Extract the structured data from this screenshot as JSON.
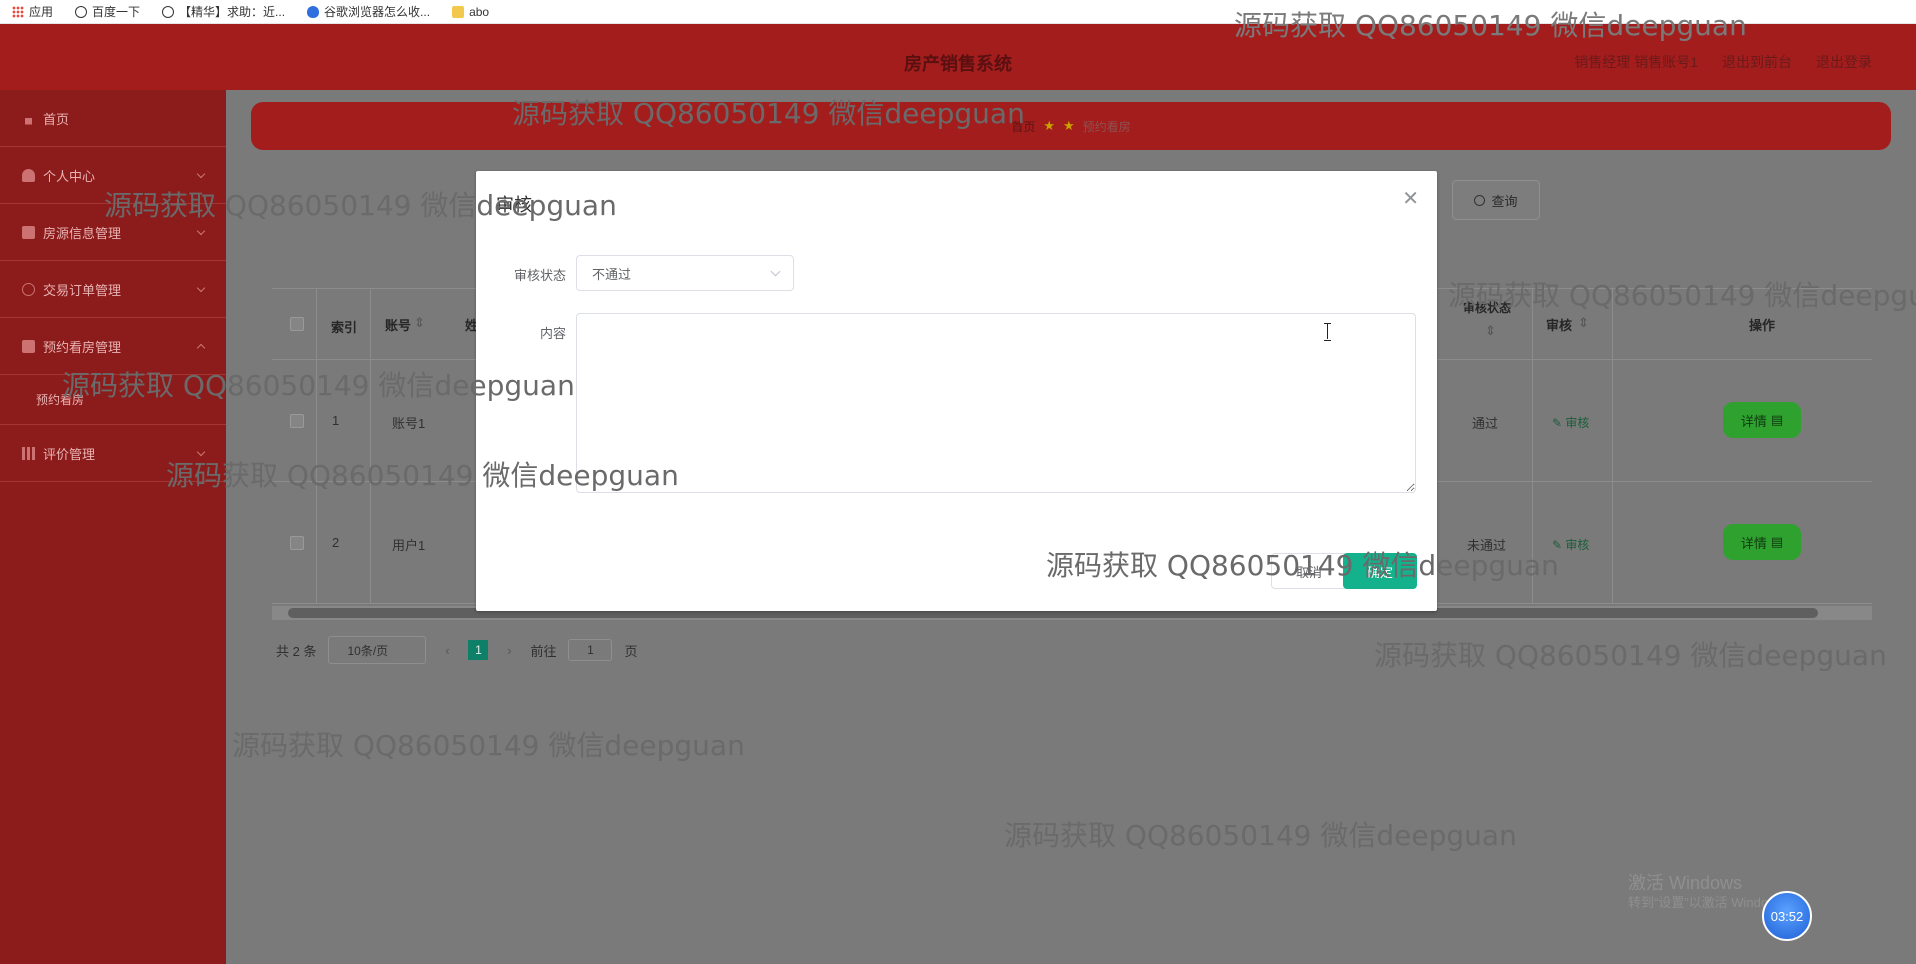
{
  "bookmarks": [
    {
      "label": "应用",
      "icon": "apps-grid-icon"
    },
    {
      "label": "百度一下",
      "icon": "globe-icon"
    },
    {
      "label": "【精华】求助：近...",
      "icon": "globe-icon"
    },
    {
      "label": "谷歌浏览器怎么收...",
      "icon": "paw-icon"
    },
    {
      "label": "abo",
      "icon": "folder-icon"
    }
  ],
  "header": {
    "title": "房产销售系统",
    "user": "销售经理 销售账号1",
    "back_to_front": "退出到前台",
    "logout": "退出登录",
    "background_color": "#a31d1d"
  },
  "sidebar": {
    "items": [
      {
        "label": "首页",
        "icon": "home-icon"
      },
      {
        "label": "个人中心",
        "icon": "user-icon"
      },
      {
        "label": "房源信息管理",
        "icon": "briefcase-icon"
      },
      {
        "label": "交易订单管理",
        "icon": "clock-icon"
      },
      {
        "label": "预约看房管理",
        "icon": "building-icon"
      },
      {
        "label": "预约看房",
        "icon": ""
      },
      {
        "label": "评价管理",
        "icon": "grid-icon"
      }
    ]
  },
  "breadcrumb": {
    "home": "首页",
    "current": "预约看房"
  },
  "query_button": "查询",
  "table": {
    "headers": [
      "索引",
      "账号",
      "姓",
      "审核状态",
      "审核",
      "操作"
    ],
    "rows": [
      {
        "index": "1",
        "account": "账号1",
        "name": "",
        "status": "通过",
        "audit": "审核",
        "action": "详情"
      },
      {
        "index": "2",
        "account": "用户1",
        "name": "",
        "status": "未通过",
        "audit": "审核",
        "action": "详情"
      }
    ]
  },
  "pagination": {
    "total": "共 2 条",
    "page_size": "10条/页",
    "current_page": "1",
    "goto_label": "前往",
    "goto_value": "1",
    "page_unit": "页"
  },
  "modal": {
    "title": "审核",
    "status_label": "审核状态",
    "status_value": "不通过",
    "content_label": "内容",
    "content_value": "",
    "cancel": "取消",
    "confirm": "确定",
    "confirm_color": "#13b28c"
  },
  "watermark": "源码获取 QQ86050149 微信deepguan",
  "os_overlay": {
    "activate_title": "激活 Windows",
    "activate_sub": "转到“设置”以激活 Windows。",
    "timer": "03:52"
  }
}
